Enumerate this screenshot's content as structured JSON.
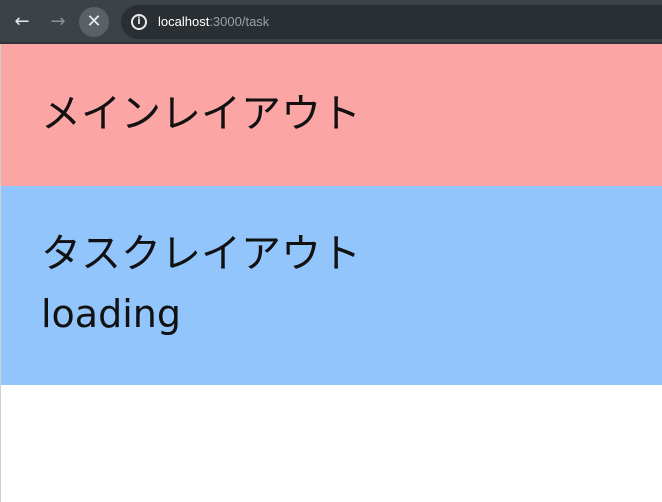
{
  "browser": {
    "back_icon": "←",
    "forward_icon": "→",
    "stop_icon": "✕",
    "info_icon": "i",
    "url_host": "localhost",
    "url_path": ":3000/task"
  },
  "main_layout": {
    "heading": "メインレイアウト",
    "background": "#fca5a5"
  },
  "task_layout": {
    "heading": "タスクレイアウト",
    "status": "loading",
    "background": "#93c5fd"
  }
}
